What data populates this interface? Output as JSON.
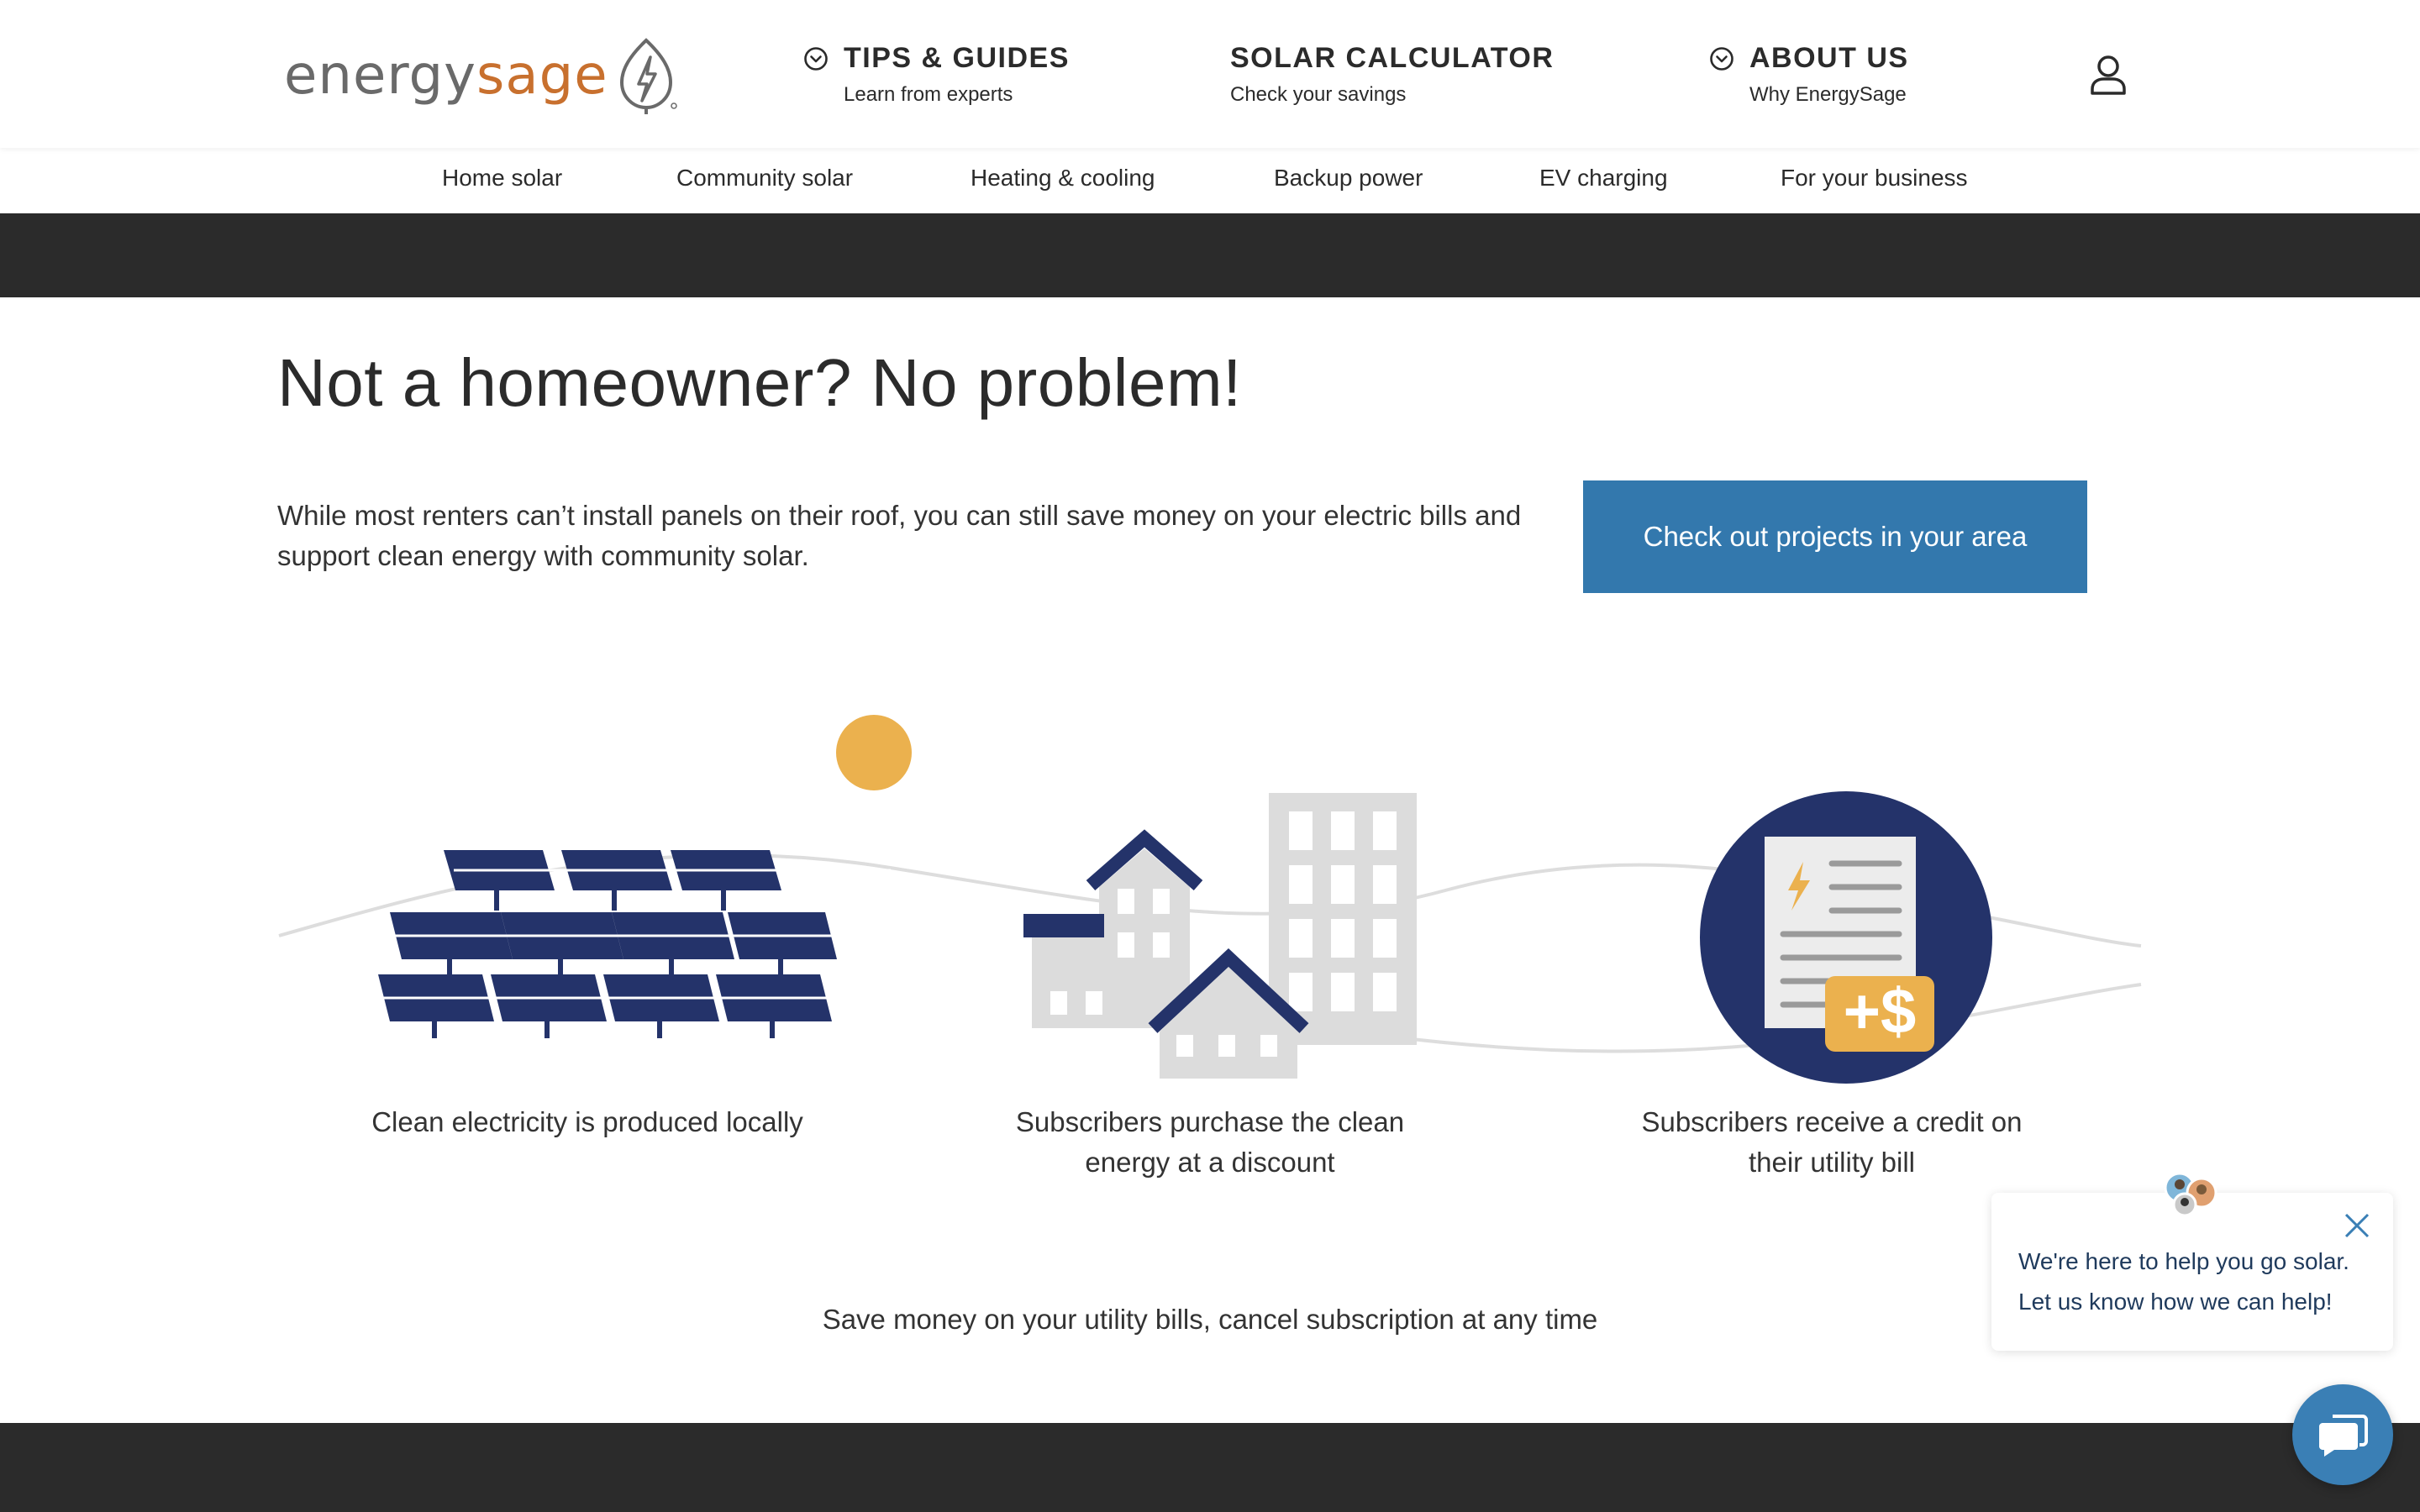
{
  "header": {
    "logo_part1": "energy",
    "logo_part2": "sage",
    "nav": [
      {
        "title": "TIPS & GUIDES",
        "subtitle": "Learn from experts"
      },
      {
        "title": "SOLAR CALCULATOR",
        "subtitle": "Check your savings"
      },
      {
        "title": "ABOUT US",
        "subtitle": "Why EnergySage"
      }
    ],
    "user_icon": "user-icon"
  },
  "subnav": [
    "Home solar",
    "Community solar",
    "Heating & cooling",
    "Backup power",
    "EV charging",
    "For your business"
  ],
  "main": {
    "headline": "Not a homeowner? No problem!",
    "intro": "While most renters can’t install panels on their roof, you can still save money on your electric bills and support clean energy with community solar.",
    "cta_label": "Check out projects in your area",
    "steps": [
      {
        "icon": "solar-panels-icon",
        "caption": "Clean electricity is produced locally"
      },
      {
        "icon": "buildings-icon",
        "caption": "Subscribers purchase the clean energy at a discount"
      },
      {
        "icon": "bill-credit-icon",
        "caption": "Subscribers receive a credit on their utility bill"
      }
    ],
    "bill_credit_badge": "+$",
    "save_text": "Save money on your utility bills, cancel subscription at any time"
  },
  "chat": {
    "line1": "We're here to help you go solar.",
    "line2": "Let us know how we can help!"
  },
  "colors": {
    "brand_orange": "#c8702e",
    "cta_blue": "#3378ad",
    "navy": "#24336a",
    "sun": "#ebb14e",
    "dark_band": "#2b2b2b"
  }
}
